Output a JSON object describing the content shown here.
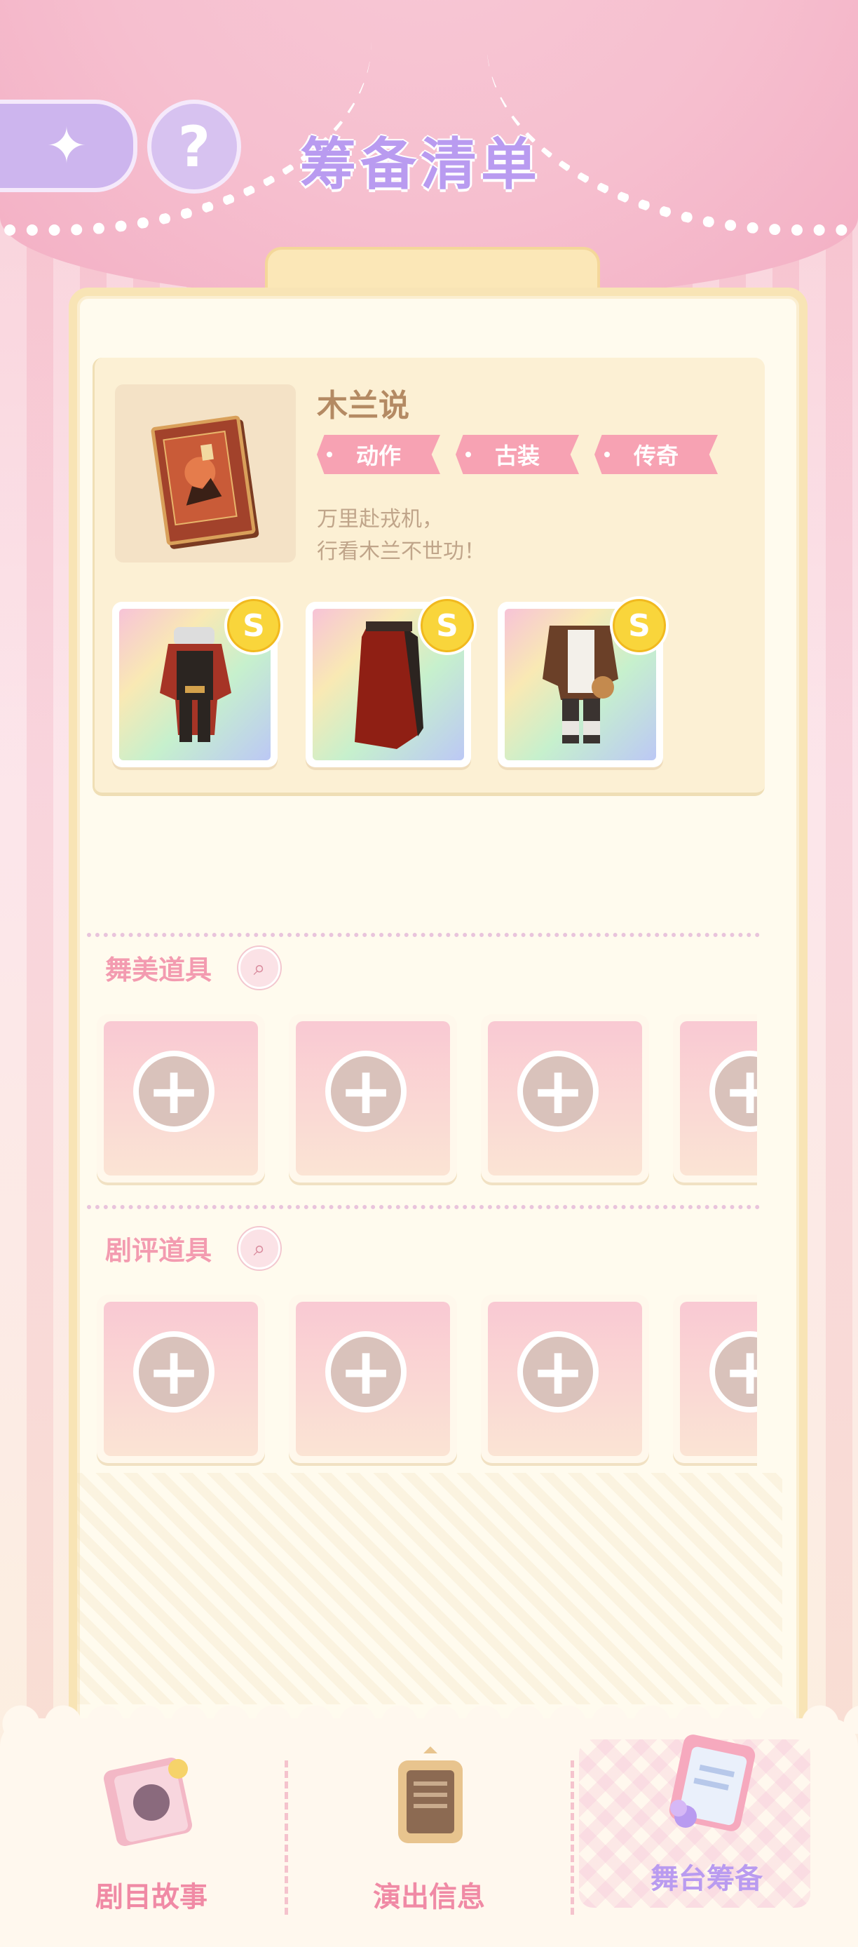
{
  "header": {
    "back_icon": "sparkle-star-icon",
    "help_label": "?",
    "title": "筹备清单"
  },
  "show": {
    "title": "木兰说",
    "tags": [
      "动作",
      "古装",
      "传奇"
    ],
    "description_lines": [
      "万里赴戎机，",
      "行看木兰不世功！"
    ]
  },
  "costumes": [
    {
      "rank": "S",
      "icon": "armored-outfit-icon"
    },
    {
      "rank": "S",
      "icon": "red-skirt-icon"
    },
    {
      "rank": "S",
      "icon": "traveler-outfit-icon"
    }
  ],
  "sections": {
    "stage_props": {
      "title": "舞美道具",
      "slots": [
        "+",
        "+",
        "+",
        "+"
      ]
    },
    "review_props": {
      "title": "剧评道具",
      "slots": [
        "+",
        "+",
        "+",
        "+"
      ]
    }
  },
  "nav": {
    "items": [
      {
        "label": "剧目故事",
        "icon": "storybook-icon",
        "active": false
      },
      {
        "label": "演出信息",
        "icon": "info-board-icon",
        "active": false
      },
      {
        "label": "舞台筹备",
        "icon": "clipboard-icon",
        "active": true
      }
    ]
  },
  "colors": {
    "accent_purple": "#b99bf0",
    "accent_pink": "#f39bb0",
    "tag_pink": "#f7a2b3",
    "rank_gold": "#f9d53b"
  }
}
